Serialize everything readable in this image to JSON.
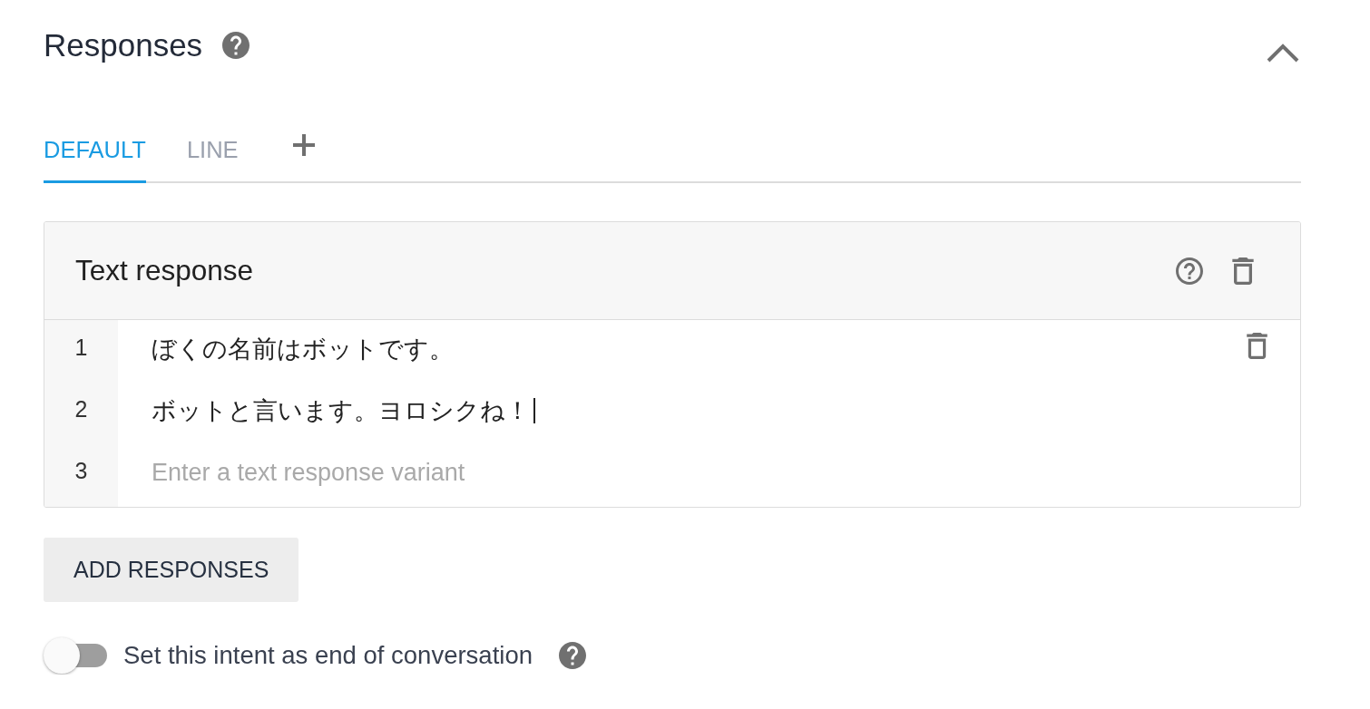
{
  "header": {
    "title": "Responses"
  },
  "tabs": [
    {
      "label": "DEFAULT",
      "selected": true
    },
    {
      "label": "LINE",
      "selected": false
    }
  ],
  "text_response": {
    "title": "Text response",
    "rows": [
      {
        "number": "1",
        "value": "ぼくの名前はボットです。",
        "focused": false,
        "hovered": true
      },
      {
        "number": "2",
        "value": "ボットと言います。ヨロシクね！",
        "focused": true,
        "hovered": false
      },
      {
        "number": "3",
        "placeholder": "Enter a text response variant",
        "focused": false,
        "hovered": false
      }
    ]
  },
  "add_button": {
    "label": "ADD RESPONSES"
  },
  "end_of_conversation": {
    "label": "Set this intent as end of conversation",
    "on": false
  }
}
